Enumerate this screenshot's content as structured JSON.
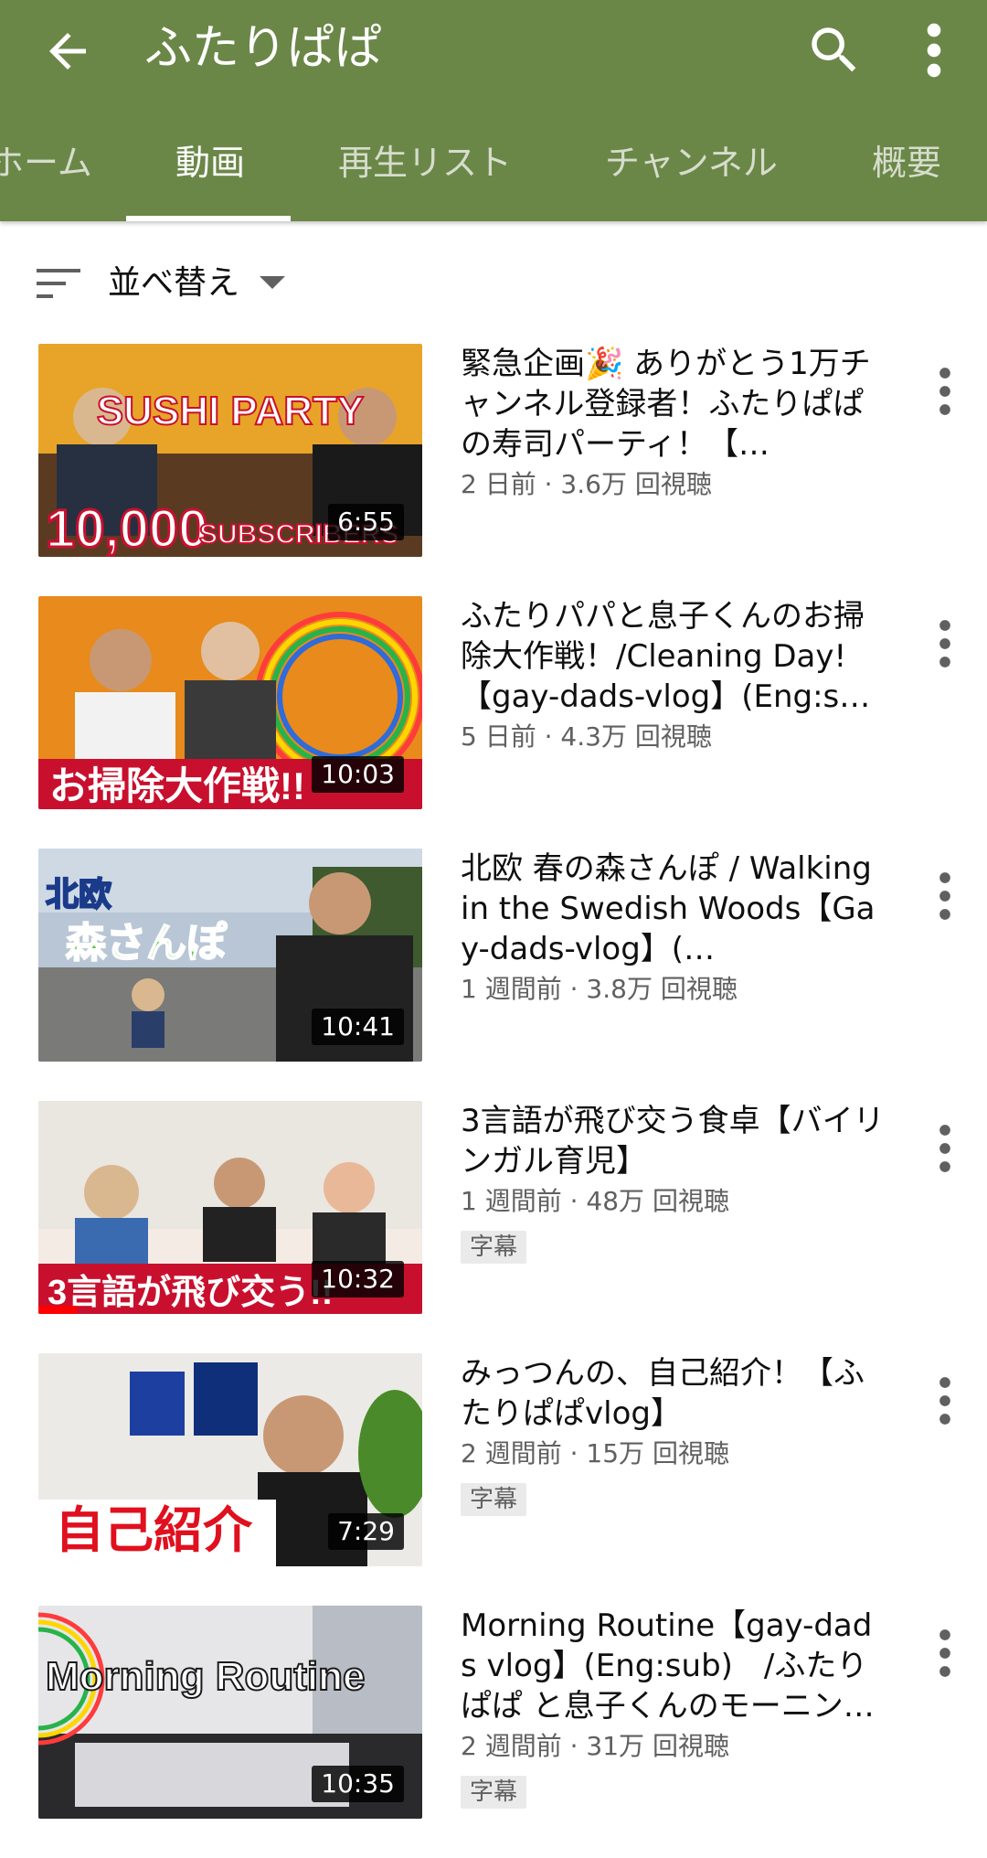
{
  "colors": {
    "appbar": "#6b8748",
    "progress": "#ff0000"
  },
  "header": {
    "title": "ふたりぱぱ",
    "back_icon": "arrow-back-icon",
    "search_icon": "search-icon",
    "more_icon": "more-vert-icon"
  },
  "tabs": [
    {
      "label": "ホーム",
      "active": false
    },
    {
      "label": "動画",
      "active": true
    },
    {
      "label": "再生リスト",
      "active": false
    },
    {
      "label": "チャンネル",
      "active": false
    },
    {
      "label": "概要",
      "active": false
    }
  ],
  "sort": {
    "label": "並べ替え",
    "icon": "sort-icon"
  },
  "videos": [
    {
      "title": "緊急企画🎉 ありがとう1万チャンネル登録者！ふたりぱぱの寿司パーティ！【…",
      "meta": "2 日前 · 3.6万 回視聴",
      "duration": "6:55",
      "thumb_text": [
        "SUSHI PARTY",
        "10,000",
        "SUBSCRIBERS"
      ],
      "badge": ""
    },
    {
      "title": "ふたりパパと息子くんのお掃除大作戦！/Cleaning Day!【gay-dads-vlog】(Eng:sub)",
      "meta": "5 日前 · 4.3万 回視聴",
      "duration": "10:03",
      "thumb_text": [
        "お掃除大作戦!!"
      ],
      "badge": ""
    },
    {
      "title": "北欧 春の森さんぽ / Walking in the Swedish Woods【Gay-dads-vlog】(…",
      "meta": "1 週間前 · 3.8万 回視聴",
      "duration": "10:41",
      "thumb_text": [
        "北欧",
        "森さんぽ"
      ],
      "badge": ""
    },
    {
      "title": "3言語が飛び交う食卓【バイリンガル育児】",
      "meta": "1 週間前 · 48万 回視聴",
      "duration": "10:32",
      "thumb_text": [
        "3言語が飛び交う!!"
      ],
      "badge": "字幕",
      "progress": 0.1
    },
    {
      "title": "みっつんの、自己紹介！【ふたりぱぱvlog】",
      "meta": "2 週間前 · 15万 回視聴",
      "duration": "7:29",
      "thumb_text": [
        "自己紹介"
      ],
      "badge": "字幕"
    },
    {
      "title": "Morning Routine【gay-dads vlog】(Eng:sub)　/ふたりぱぱ と息子くんのモーニン…",
      "meta": "2 週間前 · 31万 回視聴",
      "duration": "10:35",
      "thumb_text": [
        "Morning Routine"
      ],
      "badge": "字幕"
    }
  ]
}
